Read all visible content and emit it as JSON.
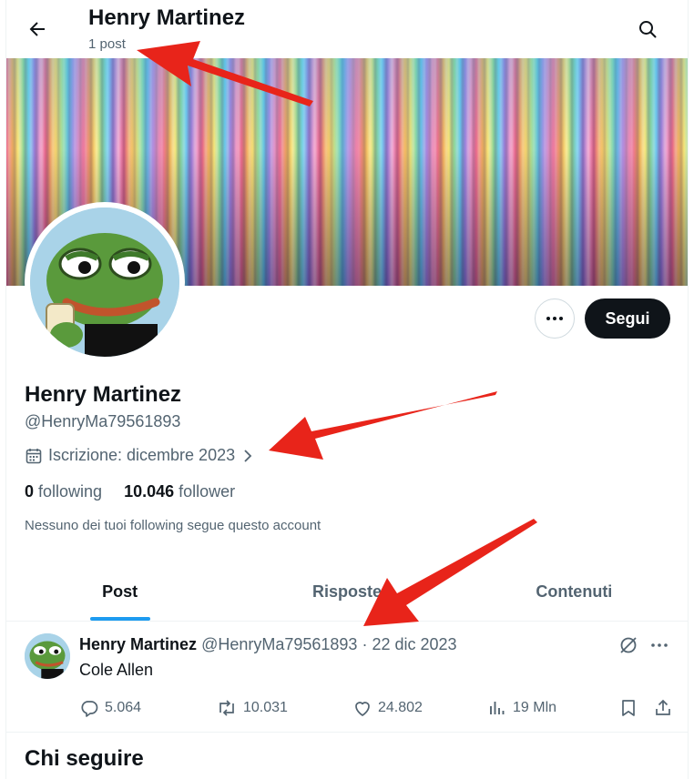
{
  "header": {
    "title": "Henry Martinez",
    "post_count": "1 post"
  },
  "profile": {
    "name": "Henry Martinez",
    "handle": "@HenryMa79561893",
    "joined": "Iscrizione: dicembre 2023",
    "following_count": "0",
    "following_label": "following",
    "follower_count": "10.046",
    "follower_label": "follower",
    "mutual_note": "Nessuno dei tuoi following segue questo account",
    "follow_button": "Segui"
  },
  "tabs": [
    {
      "label": "Post",
      "active": true
    },
    {
      "label": "Risposte",
      "active": false
    },
    {
      "label": "Contenuti",
      "active": false
    }
  ],
  "tweet": {
    "author_name": "Henry Martinez",
    "author_handle": "@HenryMa79561893",
    "separator": "·",
    "date": "22 dic 2023",
    "text": "Cole Allen",
    "replies": "5.064",
    "reposts": "10.031",
    "likes": "24.802",
    "views": "19 Mln"
  },
  "who_to_follow": {
    "title": "Chi seguire"
  },
  "colors": {
    "accent": "#1d9bf0",
    "text": "#0f1419",
    "muted": "#536471",
    "annotation_arrow": "#e8241a"
  },
  "icons": [
    "back-arrow-icon",
    "search-icon",
    "more-icon",
    "calendar-icon",
    "chevron-right-icon",
    "reply-icon",
    "repost-icon",
    "like-icon",
    "views-icon",
    "bookmark-icon",
    "share-icon",
    "grok-icon"
  ]
}
